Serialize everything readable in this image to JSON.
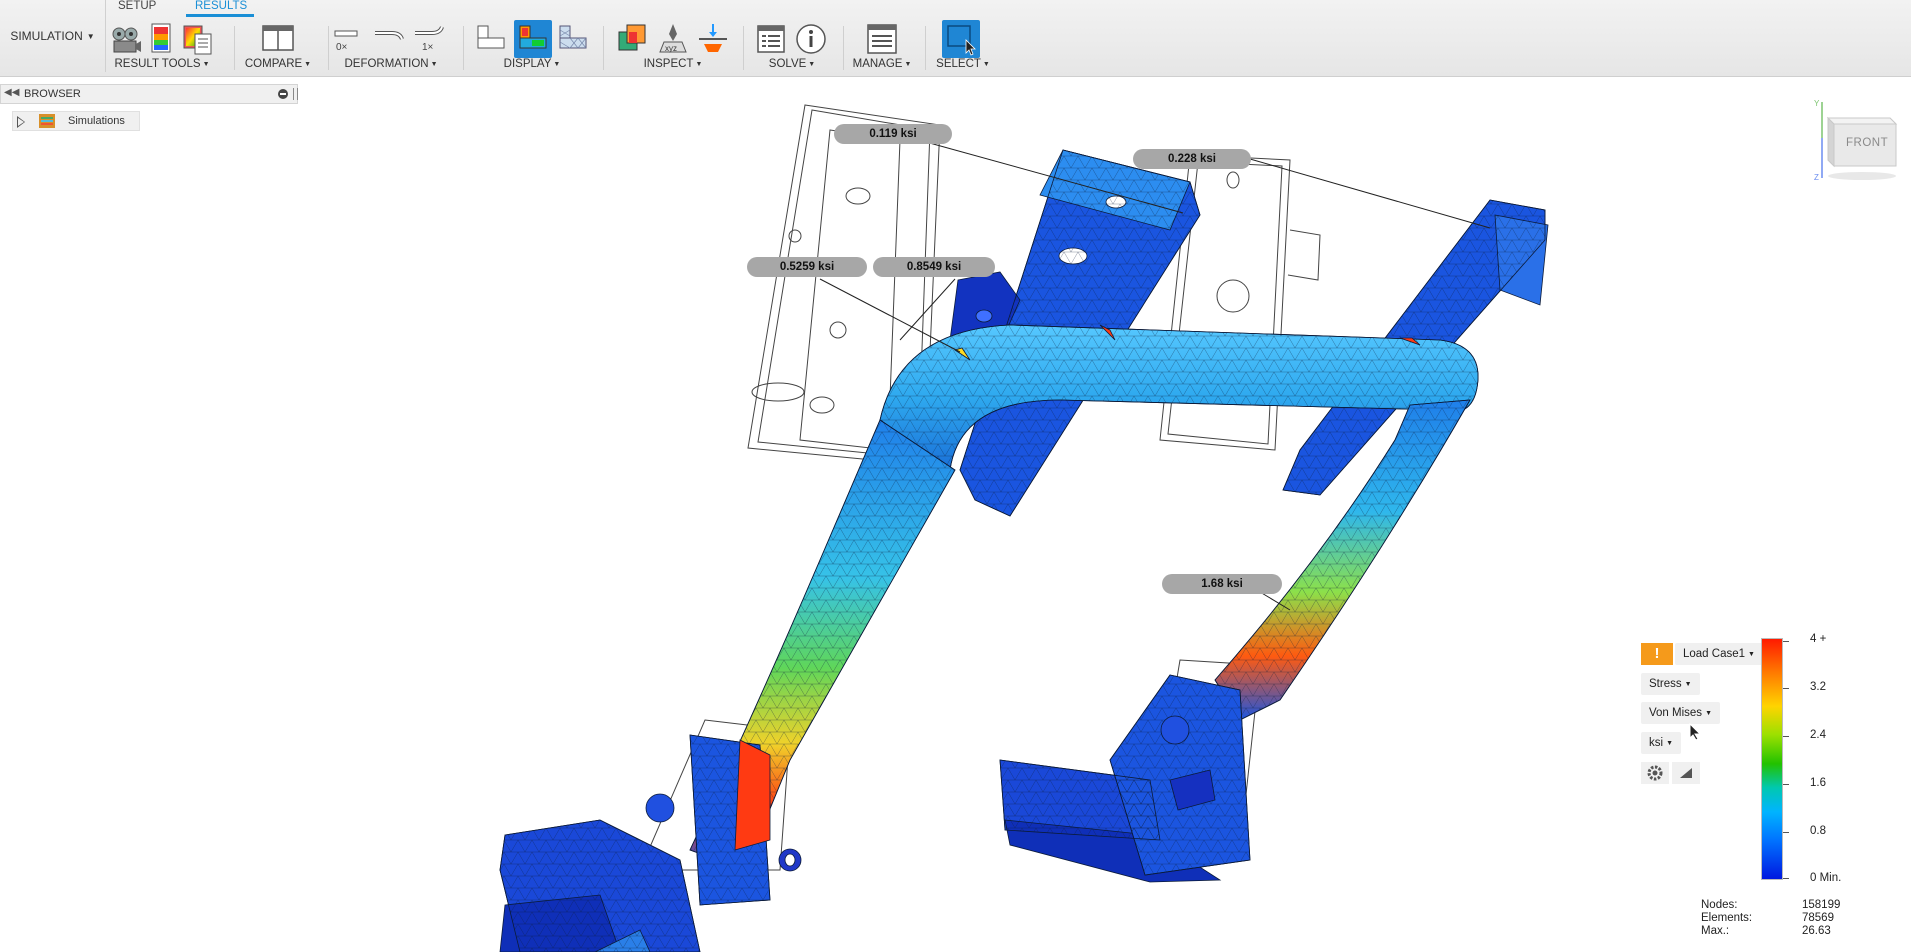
{
  "workspace": {
    "label": "SIMULATION"
  },
  "tabs": [
    {
      "label": "SETUP"
    },
    {
      "label": "RESULTS"
    }
  ],
  "toolbar": {
    "groups": [
      {
        "label": "RESULT TOOLS"
      },
      {
        "label": "COMPARE"
      },
      {
        "label": "DEFORMATION"
      },
      {
        "label": "DISPLAY"
      },
      {
        "label": "INSPECT"
      },
      {
        "label": "SOLVE"
      },
      {
        "label": "MANAGE"
      },
      {
        "label": "SELECT"
      }
    ],
    "deformation_buttons": [
      "0×",
      "1×"
    ],
    "inspect_xyz": "xyz"
  },
  "browser": {
    "title": "BROWSER",
    "root_label": "Simulations"
  },
  "probes": [
    {
      "label": "0.119 ksi"
    },
    {
      "label": "0.228 ksi"
    },
    {
      "label": "0.5259 ksi"
    },
    {
      "label": "0.8549 ksi"
    },
    {
      "label": "1.68 ksi"
    }
  ],
  "viewcube": {
    "face": "FRONT"
  },
  "legend": {
    "warning_icon": "!",
    "load_case": "Load Case1",
    "result_type": "Stress",
    "component": "Von Mises",
    "units": "ksi",
    "ticks": [
      "4 +",
      "3.2",
      "2.4",
      "1.6",
      "0.8",
      "0 Min."
    ],
    "stats": [
      {
        "label": "Nodes:",
        "value": "158199"
      },
      {
        "label": "Elements:",
        "value": "78569"
      },
      {
        "label": "Max.:",
        "value": "26.63"
      }
    ],
    "colors": {
      "max": "#ff1a00",
      "min": "#0018e0"
    }
  },
  "accent_color": "#1a8fd6"
}
